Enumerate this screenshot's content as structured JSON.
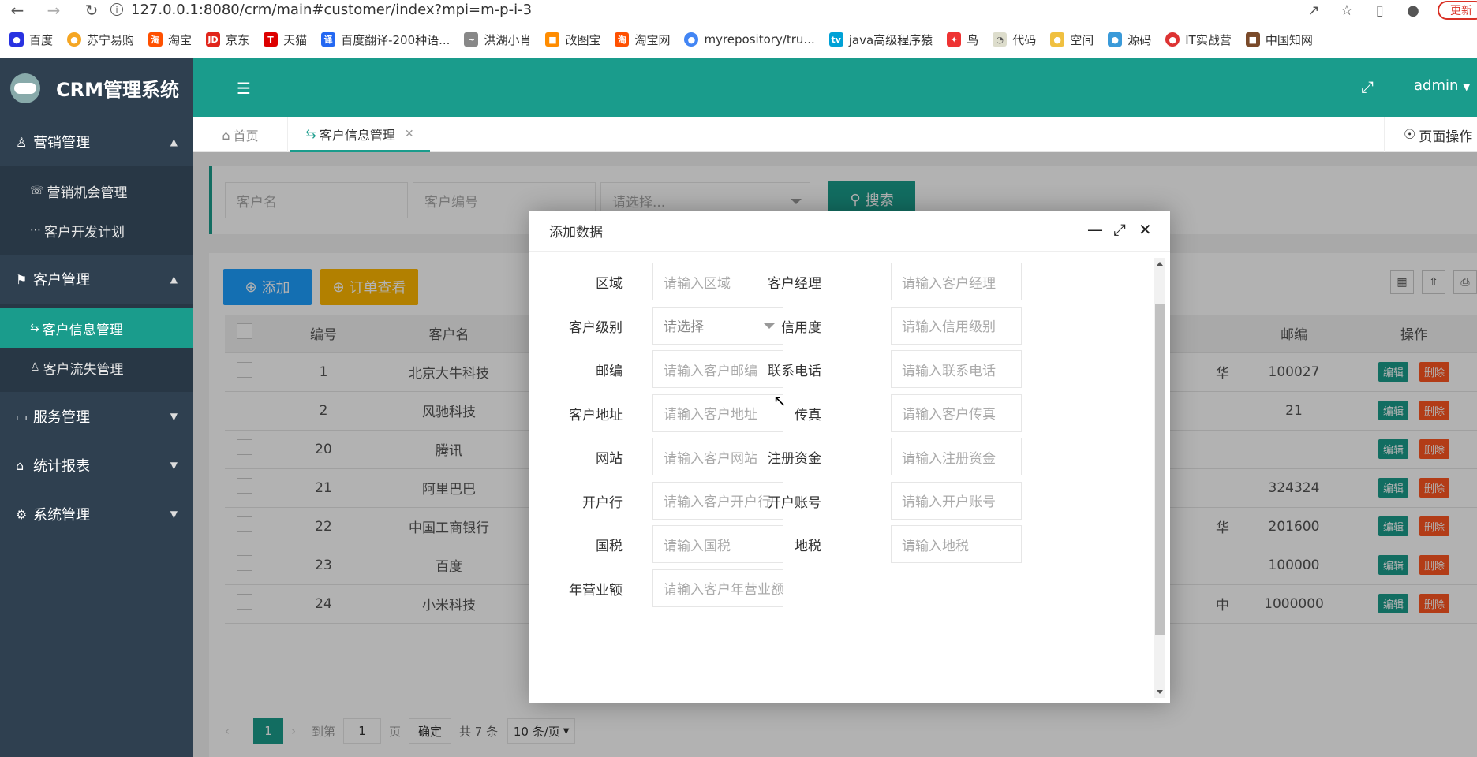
{
  "browser": {
    "url": "127.0.0.1:8080/crm/main#customer/index?mpi=m-p-i-3",
    "update_label": "更新",
    "bookmarks": [
      "百度",
      "苏宁易购",
      "淘宝",
      "京东",
      "天猫",
      "百度翻译-200种语...",
      "洪湖小肖",
      "改图宝",
      "淘宝网",
      "myrepository/tru...",
      "java高级程序猿",
      "鸟",
      "代码",
      "空间",
      "源码",
      "IT实战营",
      "中国知网"
    ]
  },
  "app": {
    "title": "CRM管理系统",
    "user": "admin",
    "sidebar": {
      "groups": [
        {
          "label": "营销管理",
          "items": [
            "营销机会管理",
            "客户开发计划"
          ]
        },
        {
          "label": "客户管理",
          "items": [
            "客户信息管理",
            "客户流失管理"
          ]
        },
        {
          "label": "服务管理"
        },
        {
          "label": "统计报表"
        },
        {
          "label": "系统管理"
        }
      ]
    },
    "tabs": {
      "home": "首页",
      "active": "客户信息管理",
      "page_ops": "页面操作"
    },
    "search": {
      "customer_name_placeholder": "客户名",
      "customer_no_placeholder": "客户编号",
      "select_placeholder": "请选择...",
      "search_label": "搜索"
    },
    "toolbar": {
      "add_label": "添加",
      "order_label": "订单查看"
    },
    "table": {
      "headers": [
        "编号",
        "客户名",
        "邮编",
        "操作"
      ],
      "rows": [
        {
          "id": "1",
          "name": "北京大牛科技",
          "zip": "100027",
          "frag": "华"
        },
        {
          "id": "2",
          "name": "风驰科技",
          "zip": "21",
          "frag": ""
        },
        {
          "id": "20",
          "name": "腾讯",
          "zip": "",
          "frag": ""
        },
        {
          "id": "21",
          "name": "阿里巴巴",
          "zip": "324324",
          "frag": ""
        },
        {
          "id": "22",
          "name": "中国工商银行",
          "zip": "201600",
          "frag": "华"
        },
        {
          "id": "23",
          "name": "百度",
          "zip": "100000",
          "frag": ""
        },
        {
          "id": "24",
          "name": "小米科技",
          "zip": "1000000",
          "frag": "中"
        }
      ],
      "edit_label": "编辑",
      "delete_label": "删除"
    },
    "pager": {
      "current": "1",
      "goto_label": "到第",
      "goto_value": "1",
      "page_label": "页",
      "confirm": "确定",
      "total": "共 7 条",
      "per_page": "10 条/页"
    }
  },
  "modal": {
    "title": "添加数据",
    "fields": [
      {
        "label": "区域",
        "placeholder": "请输入区域"
      },
      {
        "label": "客户经理",
        "placeholder": "请输入客户经理"
      },
      {
        "label": "客户级别",
        "placeholder": "请选择"
      },
      {
        "label": "信用度",
        "placeholder": "请输入信用级别"
      },
      {
        "label": "邮编",
        "placeholder": "请输入客户邮编"
      },
      {
        "label": "联系电话",
        "placeholder": "请输入联系电话"
      },
      {
        "label": "客户地址",
        "placeholder": "请输入客户地址"
      },
      {
        "label": "传真",
        "placeholder": "请输入客户传真"
      },
      {
        "label": "网站",
        "placeholder": "请输入客户网站"
      },
      {
        "label": "注册资金",
        "placeholder": "请输入注册资金"
      },
      {
        "label": "开户行",
        "placeholder": "请输入客户开户行"
      },
      {
        "label": "开户账号",
        "placeholder": "请输入开户账号"
      },
      {
        "label": "国税",
        "placeholder": "请输入国税"
      },
      {
        "label": "地税",
        "placeholder": "请输入地税"
      },
      {
        "label": "年营业额",
        "placeholder": "请输入客户年营业额"
      }
    ]
  },
  "colors": {
    "primary": "#1a9c8c",
    "sidebar": "#2f4050",
    "danger": "#ff5722",
    "warning": "#ffb800",
    "blue": "#1e9fff"
  }
}
